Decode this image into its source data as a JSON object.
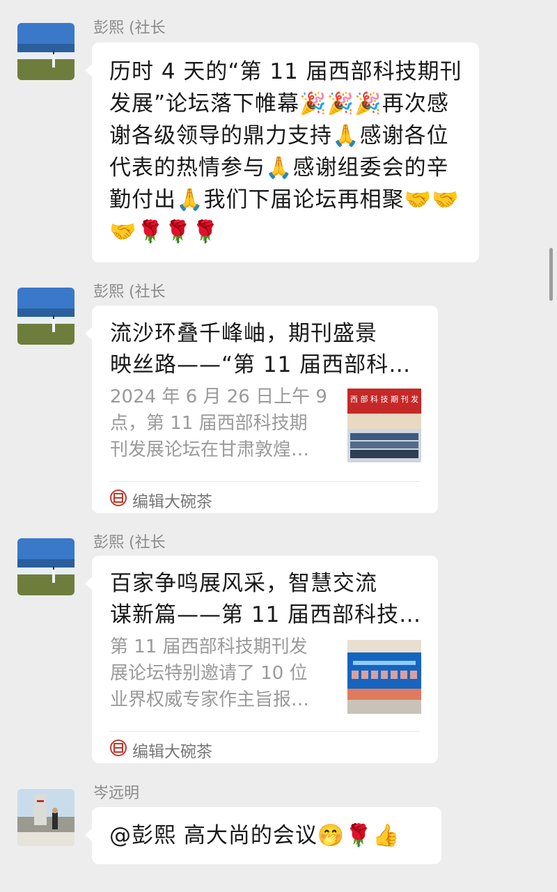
{
  "messages": [
    {
      "sender": "彭熙 (社长",
      "type": "text",
      "text": "历时 4 天的“第 11 届西部科技期刊发展”论坛落下帷幕🎉🎉🎉再次感谢各级领导的鼎力支持🙏感谢各位代表的热情参与🙏感谢组委会的辛勤付出🙏我们下届论坛再相聚🤝🤝🤝🌹🌹🌹"
    },
    {
      "sender": "彭熙 (社长",
      "type": "link_card",
      "title": "流沙环叠千峰岫，期刊盛景\n映丝路——“第 11 届西部科…",
      "description": "2024 年 6 月 26 日上午 9\n点，第 11 届西部科技期\n刊发展论坛在甘肃敦煌…",
      "thumbnail_banner": "西 部 科 技 期 刊 发",
      "source": "编辑大碗茶"
    },
    {
      "sender": "彭熙 (社长",
      "type": "link_card",
      "title": "百家争鸣展风采，智慧交流\n谋新篇——第 11 届西部科技…",
      "description": "第 11 届西部科技期刊发\n展论坛特别邀请了 10 位\n业界权威专家作主旨报…",
      "source": "编辑大碗茶"
    },
    {
      "sender": "岑远明",
      "type": "text",
      "text": "@彭熙 高大尚的会议🤭🌹👍"
    }
  ],
  "colors": {
    "background": "#ededed",
    "bubble": "#ffffff",
    "sender_text": "#8a8a8a",
    "source_icon": "#c0392b"
  },
  "icons": [
    "avatar-landscape",
    "source-seal-icon"
  ]
}
